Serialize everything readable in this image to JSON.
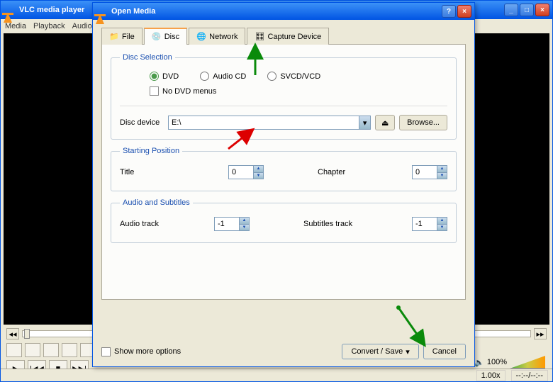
{
  "outer_window": {
    "title": "VLC media player",
    "menu": [
      "Media",
      "Playback",
      "Audio"
    ]
  },
  "dialog": {
    "title": "Open Media",
    "tabs": {
      "file": "File",
      "disc": "Disc",
      "network": "Network",
      "capture": "Capture Device"
    },
    "disc_selection": {
      "legend": "Disc Selection",
      "dvd": "DVD",
      "audio_cd": "Audio CD",
      "svcd": "SVCD/VCD",
      "no_menus": "No DVD menus",
      "device_label": "Disc device",
      "device_value": "E:\\",
      "browse": "Browse..."
    },
    "starting_position": {
      "legend": "Starting Position",
      "title_label": "Title",
      "title_value": "0",
      "chapter_label": "Chapter",
      "chapter_value": "0"
    },
    "audio_subtitles": {
      "legend": "Audio and Subtitles",
      "audio_label": "Audio track",
      "audio_value": "-1",
      "subs_label": "Subtitles track",
      "subs_value": "-1"
    },
    "show_more": "Show more options",
    "convert": "Convert / Save",
    "cancel": "Cancel"
  },
  "status": {
    "volume": "100%",
    "speed": "1.00x",
    "time": "--:--/--:--"
  }
}
